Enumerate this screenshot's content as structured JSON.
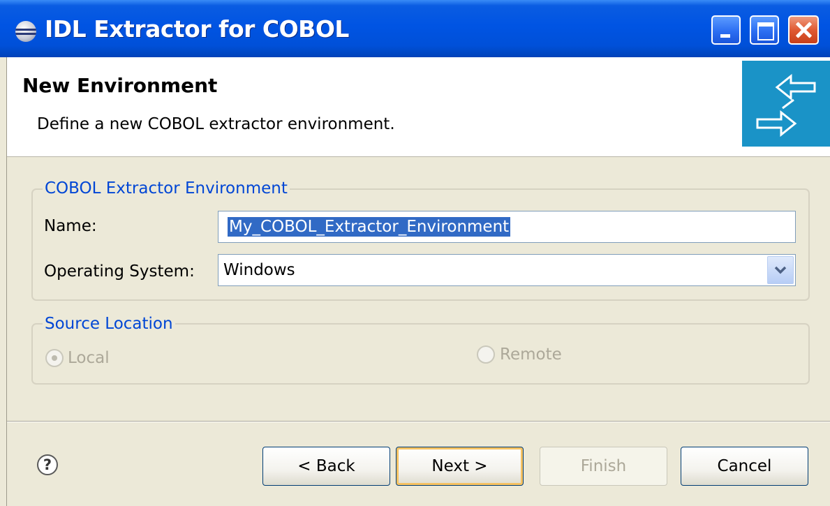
{
  "window": {
    "title": "IDL Extractor for COBOL"
  },
  "banner": {
    "title": "New Environment",
    "description": "Define a new COBOL extractor environment."
  },
  "environment_group": {
    "legend": "COBOL Extractor Environment",
    "name_label": "Name:",
    "name_value": "My_COBOL_Extractor_Environment",
    "os_label": "Operating System:",
    "os_value": "Windows"
  },
  "source_group": {
    "legend": "Source Location",
    "local_label": "Local",
    "local_selected": true,
    "remote_label": "Remote",
    "remote_selected": false,
    "enabled": false
  },
  "buttons": {
    "back": "< Back",
    "next": "Next >",
    "finish": "Finish",
    "cancel": "Cancel",
    "finish_enabled": false
  },
  "icons": {
    "app": "eclipse-icon",
    "banner": "exchange-arrows-icon",
    "help": "help-icon"
  },
  "colors": {
    "titlebar": "#0054e3",
    "banner_logo": "#1a93c7",
    "legend_text": "#0046d5",
    "selection": "#316ac5"
  }
}
